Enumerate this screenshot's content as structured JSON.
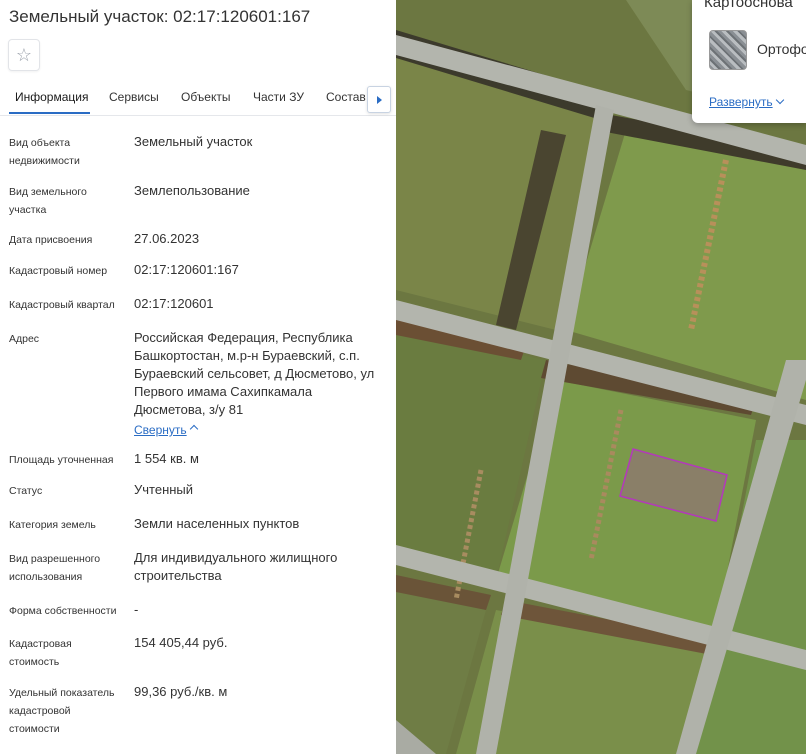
{
  "header": {
    "title": "Земельный участок: 02:17:120601:167",
    "favorite_icon": "star-outline-icon"
  },
  "tabs": [
    {
      "label": "Информация",
      "active": true
    },
    {
      "label": "Сервисы",
      "active": false
    },
    {
      "label": "Объекты",
      "active": false
    },
    {
      "label": "Части ЗУ",
      "active": false
    },
    {
      "label": "Состав",
      "active": false
    }
  ],
  "info": {
    "object_type": {
      "label": "Вид объекта недвижимости",
      "value": "Земельный участок"
    },
    "parcel_type": {
      "label": "Вид земельного участка",
      "value": "Землепользование"
    },
    "assigned_date": {
      "label": "Дата присвоения",
      "value": "27.06.2023"
    },
    "cadastral_number": {
      "label": "Кадастровый номер",
      "value": "02:17:120601:167"
    },
    "cadastral_quarter": {
      "label": "Кадастровый квартал",
      "value": "02:17:120601"
    },
    "address": {
      "label": "Адрес",
      "value": "Российская Федерация, Республика Башкортостан, м.р-н Бураевский, с.п. Бураевский сельсовет, д Дюсметово, ул Первого имама Сахипкамала Дюсметова, з/у 81"
    },
    "collapse_link": "Свернуть",
    "area": {
      "label": "Площадь уточненная",
      "value": "1 554 кв. м"
    },
    "status": {
      "label": "Статус",
      "value": "Учтенный"
    },
    "land_category": {
      "label": "Категория земель",
      "value": "Земли населенных пунктов"
    },
    "permitted_use": {
      "label": "Вид разрешенного использования",
      "value": "Для индивидуального жилищного строительства"
    },
    "ownership_form": {
      "label": "Форма собственности",
      "value": "-"
    },
    "cadastral_value": {
      "label": "Кадастровая стоимость",
      "value": "154 405,44 руб."
    },
    "specific_value": {
      "label": "Удельный показатель кадастровой стоимости",
      "value": "99,36 руб./кв. м"
    }
  },
  "basemap": {
    "title": "Картооснова",
    "option_label": "Ортофото",
    "expand_link": "Развернуть"
  },
  "colors": {
    "accent": "#2a6cc4",
    "parcel_outline": "#b23bb8"
  }
}
